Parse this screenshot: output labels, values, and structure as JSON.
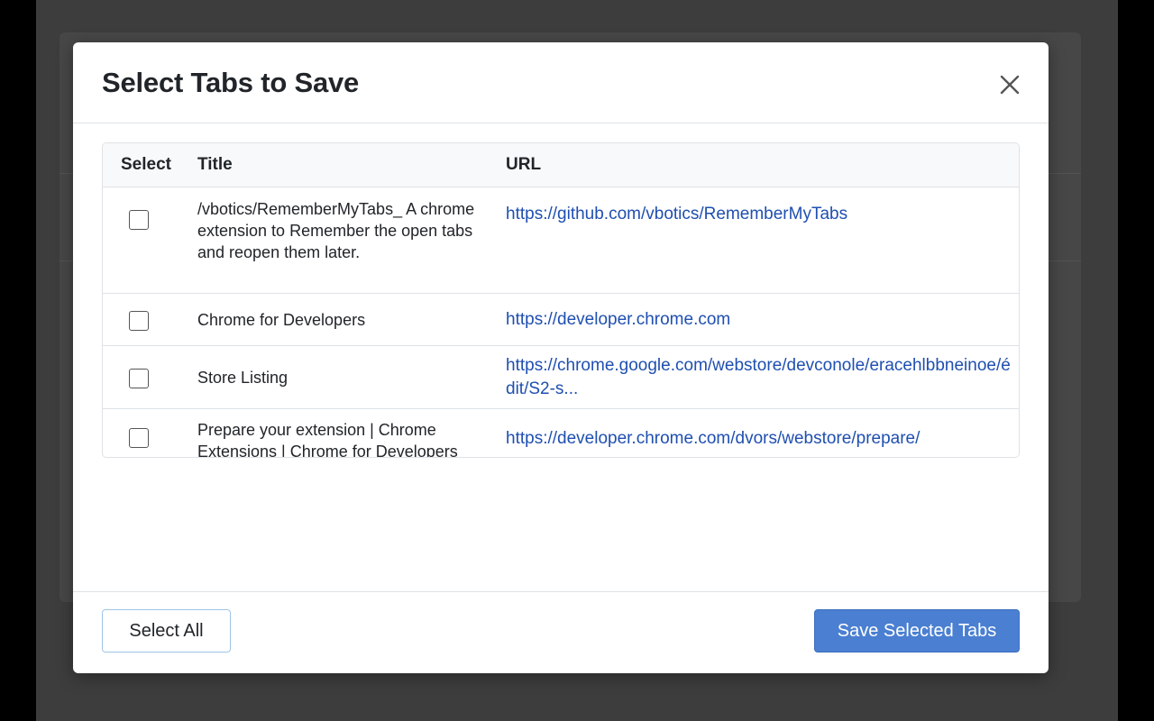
{
  "dialog": {
    "title": "Select Tabs to Save",
    "close_icon": "close-icon"
  },
  "table": {
    "headers": {
      "select": "Select",
      "title": "Title",
      "url": "URL"
    },
    "rows": [
      {
        "title": "/vbotics/RememberMyTabs_ A chrome extension to Remember the open tabs and reopen them later.",
        "url": "https://github.com/vbotics/RememberMyTabs",
        "checked": false
      },
      {
        "title": "Chrome for Developers",
        "url": "https://developer.chrome.com",
        "checked": false
      },
      {
        "title": "Store Listing",
        "url": "https://chrome.google.com/webstore/devconole/eracehlbbneinoe/édit/S2-s...",
        "checked": false
      },
      {
        "title": "Prepare your extension | Chrome Extensions | Chrome for Developers",
        "url": "https://developer.chrome.com/dvors/webstore/prepare/",
        "checked": false
      }
    ]
  },
  "footer": {
    "select_all_label": "Select All",
    "save_label": "Save Selected Tabs"
  },
  "colors": {
    "primary": "#4a7fd1",
    "link": "#1f4fb0",
    "backdrop": "#3d3d3d"
  }
}
